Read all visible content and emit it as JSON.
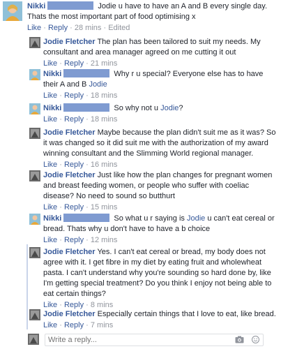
{
  "top_comment": {
    "author": "Nikki",
    "text_a": "Jodie u have to have an A and B every single day. Thats the most important part of food optimising x",
    "like": "Like",
    "reply": "Reply",
    "time": "28 mins",
    "edited": "Edited"
  },
  "replies": [
    {
      "author": "Jodie Fletcher",
      "text": "The plan has been tailored to suit my needs. My consultant and area manager agreed on me cutting it out",
      "like": "Like",
      "reply": "Reply",
      "time": "21 mins"
    },
    {
      "author": "Nikki",
      "text_a": "Why r u special? Everyone else has to have their A and B ",
      "mention": "Jodie",
      "like": "Like",
      "reply": "Reply",
      "time": "18 mins"
    },
    {
      "author": "Nikki",
      "text_a": "So why not u ",
      "mention": "Jodie",
      "text_b": "?",
      "like": "Like",
      "reply": "Reply",
      "time": "18 mins"
    },
    {
      "author": "Jodie Fletcher",
      "text": "Maybe because the plan didn't suit me as it was? So it was changed so it did suit me with the authorization of my award winning consultant and the Slimming World regional manager.",
      "like": "Like",
      "reply": "Reply",
      "time": "16 mins"
    },
    {
      "author": "Jodie Fletcher",
      "text": "Just like how the plan changes for pregnant women and breast feeding women, or people who suffer with coeliac disease? No need to sound so butthurt",
      "like": "Like",
      "reply": "Reply",
      "time": "15 mins"
    },
    {
      "author": "Nikki",
      "text_a": "So what u r saying is ",
      "mention": "Jodie",
      "text_b": " u can't eat cereal or bread. Thats why u don't have to have a b choice",
      "like": "Like",
      "reply": "Reply",
      "time": "12 mins"
    },
    {
      "author": "Jodie Fletcher",
      "text": "Yes. I can't eat cereal or bread, my body does not agree with it. I get fibre in my diet by eating fruit and wholewheat pasta. I can't understand why you're sounding so hard done by, like I'm getting special treatment? Do you think I enjoy not being able to eat certain things?",
      "like": "Like",
      "reply": "Reply",
      "time": "8 mins"
    },
    {
      "author": "Jodie Fletcher",
      "text": "Especially certain things that I love to eat, like bread.",
      "like": "Like",
      "reply": "Reply",
      "time": "7 mins"
    }
  ],
  "composer": {
    "placeholder": "Write a reply...",
    "icons": [
      "camera-icon",
      "emoji-icon"
    ]
  },
  "colors": {
    "link": "#365899",
    "meta": "#90949c",
    "redaction": "#7f9bd1"
  }
}
